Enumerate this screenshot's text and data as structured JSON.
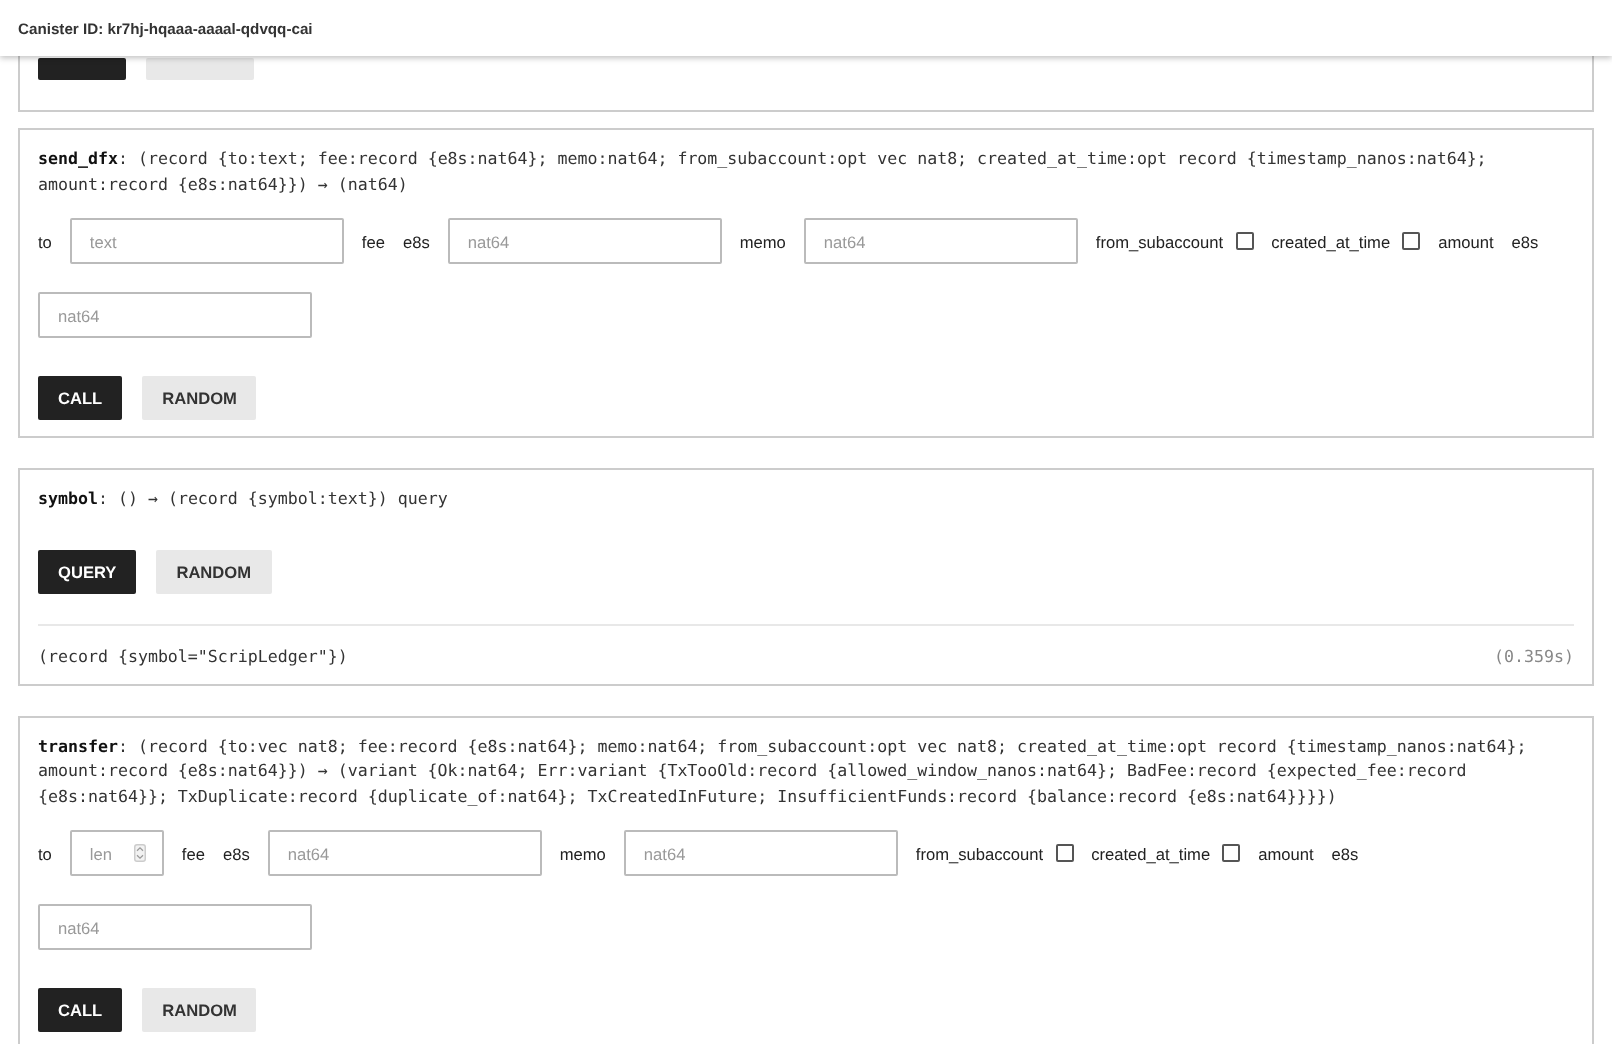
{
  "header": {
    "canister_id": "Canister ID: kr7hj-hqaaa-aaaal-qdvqq-cai"
  },
  "methods": [
    {
      "buttons": [
        {
          "kind": "primary"
        },
        {
          "kind": "secondary"
        }
      ]
    },
    {
      "signature": "**send_dfx**: (record {to:text; fee:record {e8s:nat64}; memo:nat64; from_subaccount:opt vec nat8; created_at_time:opt record {timestamp_nanos:nat64};\namount:record {e8s:nat64}}) → (nat64)",
      "rows": [
        [
          {
            "kind": "label",
            "text": "to"
          },
          {
            "kind": "input",
            "placeholder": "text"
          },
          {
            "kind": "label",
            "text": "fee"
          },
          {
            "kind": "label",
            "text": "e8s"
          },
          {
            "kind": "input",
            "placeholder": "nat64"
          },
          {
            "kind": "label",
            "text": "memo"
          },
          {
            "kind": "input",
            "placeholder": "nat64"
          },
          {
            "kind": "label",
            "text": "from_subaccount"
          },
          {
            "kind": "checkbox",
            "checked": false
          },
          {
            "kind": "label",
            "text": "created_at_time"
          },
          {
            "kind": "checkbox",
            "checked": false
          },
          {
            "kind": "label",
            "text": "amount"
          },
          {
            "kind": "label",
            "text": "e8s"
          }
        ],
        [
          {
            "kind": "input",
            "placeholder": "nat64"
          }
        ]
      ],
      "buttons": [
        {
          "label": "CALL",
          "kind": "primary"
        },
        {
          "label": "RANDOM",
          "kind": "secondary"
        }
      ]
    },
    {
      "signature": "**symbol**: () → (record {symbol:text}) query",
      "buttons": [
        {
          "label": "QUERY",
          "kind": "primary"
        },
        {
          "label": "RANDOM",
          "kind": "secondary"
        }
      ],
      "result": {
        "value": "(record {symbol=\"ScripLedger\"})",
        "time": "(0.359s)"
      }
    },
    {
      "signature": "**transfer**: (record {to:vec nat8; fee:record {e8s:nat64}; memo:nat64; from_subaccount:opt vec nat8; created_at_time:opt record {timestamp_nanos:nat64};\namount:record {e8s:nat64}}) → (variant {Ok:nat64; Err:variant {TxTooOld:record {allowed_window_nanos:nat64}; BadFee:record {expected_fee:record\n{e8s:nat64}}; TxDuplicate:record {duplicate_of:nat64}; TxCreatedInFuture; InsufficientFunds:record {balance:record {e8s:nat64}}}})",
      "rows": [
        [
          {
            "kind": "label",
            "text": "to"
          },
          {
            "kind": "number",
            "placeholder": "len"
          },
          {
            "kind": "label",
            "text": "fee"
          },
          {
            "kind": "label",
            "text": "e8s"
          },
          {
            "kind": "input",
            "placeholder": "nat64"
          },
          {
            "kind": "label",
            "text": "memo"
          },
          {
            "kind": "input",
            "placeholder": "nat64"
          },
          {
            "kind": "label",
            "text": "from_subaccount"
          },
          {
            "kind": "checkbox",
            "checked": false
          },
          {
            "kind": "label",
            "text": "created_at_time"
          },
          {
            "kind": "checkbox",
            "checked": false
          },
          {
            "kind": "label",
            "text": "amount"
          },
          {
            "kind": "label",
            "text": "e8s"
          }
        ],
        [
          {
            "kind": "input",
            "placeholder": "nat64"
          }
        ]
      ],
      "buttons": [
        {
          "label": "CALL",
          "kind": "primary"
        },
        {
          "label": "RANDOM",
          "kind": "secondary"
        }
      ]
    }
  ]
}
